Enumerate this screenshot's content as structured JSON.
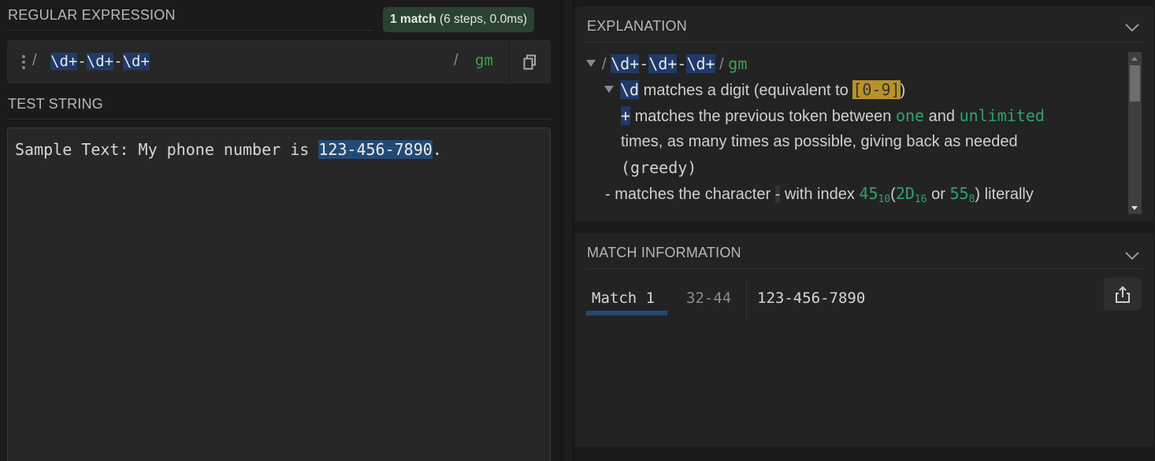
{
  "regex_section": {
    "title": "REGULAR EXPRESSION",
    "match_badge": {
      "count": "1 match",
      "detail": "(6 steps, 0.0ms)"
    },
    "delimiter_open": "/",
    "pattern_tokens": [
      "\\d+",
      "-",
      "\\d+",
      "-",
      "\\d+"
    ],
    "delimiter_close": "/",
    "flags": "gm",
    "copy_icon": "copy-icon",
    "drag_icon": "vertical-dots-icon"
  },
  "test_section": {
    "title": "TEST STRING",
    "text_before": "Sample Text: My phone number is ",
    "text_match": "123-456-7890",
    "text_after": "."
  },
  "explanation": {
    "title": "EXPLANATION",
    "collapse_icon": "chevron-down-icon",
    "root": {
      "slash_open": "/",
      "tokens": [
        "\\d+",
        "-",
        "\\d+",
        "-",
        "\\d+"
      ],
      "slash_close": "/",
      "flags": "gm"
    },
    "digit": {
      "token": "\\d",
      "text": "matches a digit (equivalent to",
      "range": "[0-9]",
      "close": ")"
    },
    "quantifier": {
      "token": "+",
      "text1": "matches the previous token between",
      "one": "one",
      "and": "and",
      "unlimited": "unlimited",
      "text2": "times, as many times as possible, giving back as needed",
      "greedy": "(greedy)"
    },
    "literal": {
      "token": "-",
      "text1": "matches the character",
      "char": "-",
      "text2": "with index",
      "dec": "45",
      "dec_base": "10",
      "open": "(",
      "hex": "2D",
      "hex_base": "16",
      "or": "or",
      "oct": "55",
      "oct_base": "8",
      "text3": ") literally"
    }
  },
  "match_info": {
    "title": "MATCH INFORMATION",
    "collapse_icon": "chevron-down-icon",
    "match_label": "Match 1",
    "range": "32-44",
    "value": "123-456-7890",
    "export_icon": "export-icon"
  },
  "colors": {
    "token_highlight": "#1f3a68",
    "match_highlight": "#234a73",
    "flag_green": "#3fa34d",
    "badge_bg": "#2a4231",
    "range_gold": "#b8922a"
  }
}
